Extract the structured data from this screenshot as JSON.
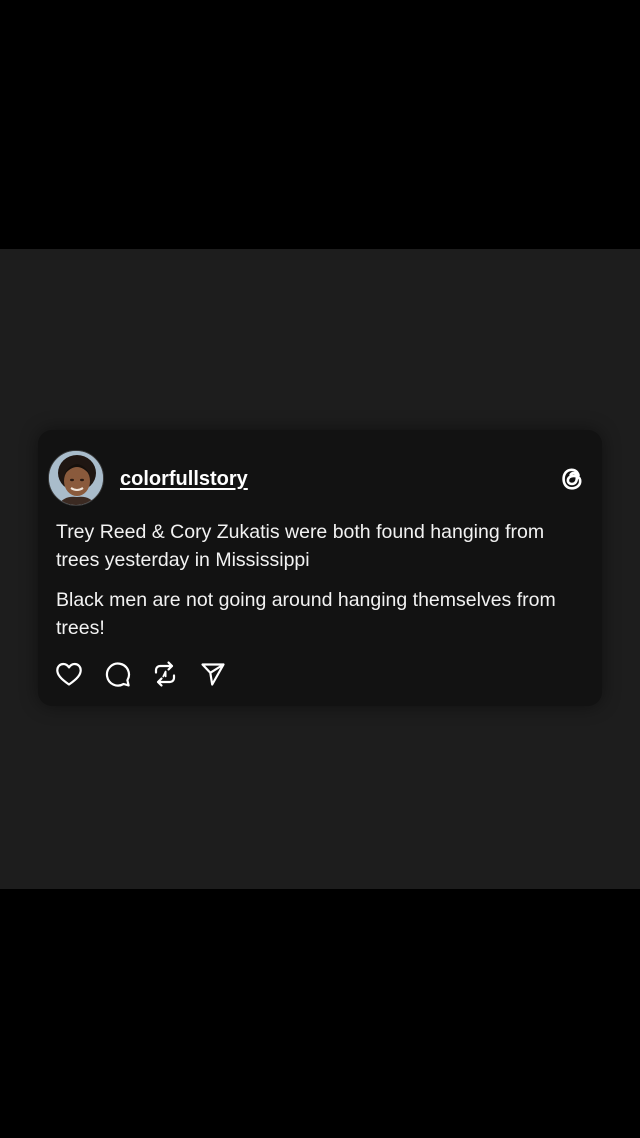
{
  "post": {
    "username": "colorfullstory",
    "paragraphs": [
      "Trey Reed & Cory Zukatis were both found hanging from trees yesterday in Mississippi",
      "Black men are not going around hanging themselves from trees!"
    ]
  },
  "icons": {
    "platform": "threads-logo-icon",
    "actions": [
      "heart-icon",
      "comment-icon",
      "repost-icon",
      "share-icon"
    ]
  },
  "colors": {
    "outer_background": "#000000",
    "panel_background": "#1d1d1d",
    "card_background": "#121212",
    "text": "#ffffff"
  }
}
